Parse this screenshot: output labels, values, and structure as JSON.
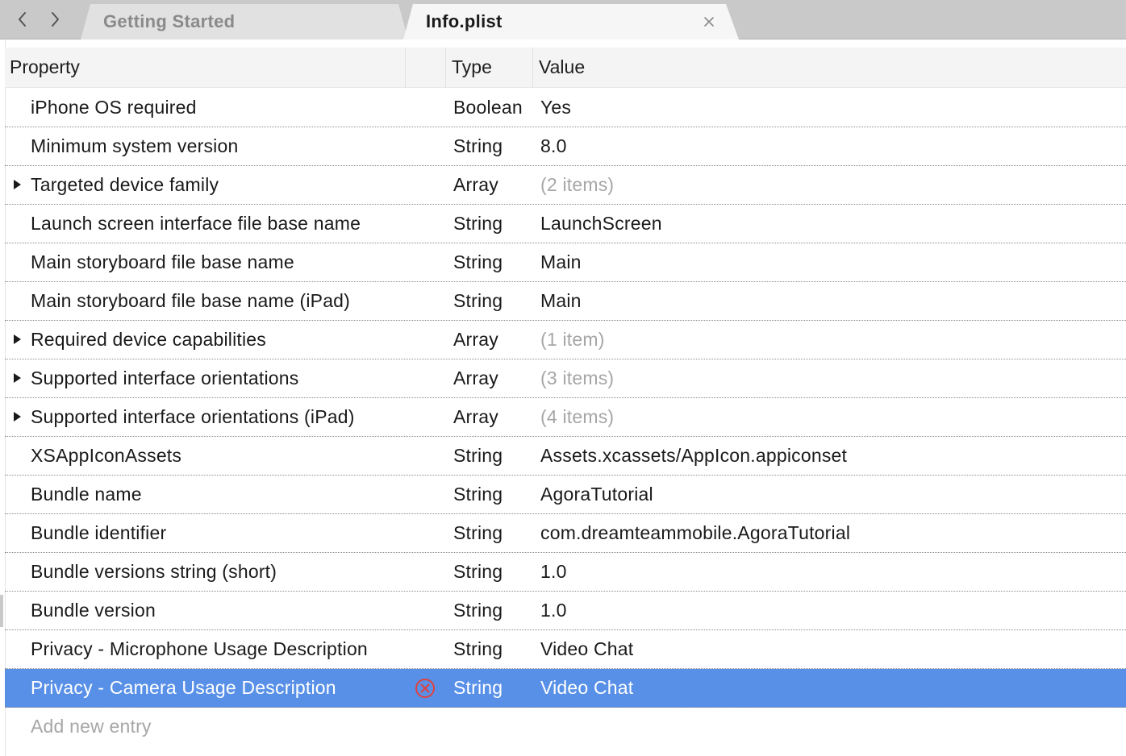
{
  "nav": {
    "back_icon": "chevron-left-icon",
    "forward_icon": "chevron-right-icon"
  },
  "tabs": [
    {
      "label": "Getting Started",
      "active": false
    },
    {
      "label": "Info.plist",
      "active": true,
      "close_icon": "close-icon"
    }
  ],
  "columns": {
    "property": "Property",
    "type": "Type",
    "value": "Value"
  },
  "rows": [
    {
      "property": "iPhone OS required",
      "type": "Boolean",
      "value": "Yes",
      "expandable": false,
      "muted": false
    },
    {
      "property": "Minimum system version",
      "type": "String",
      "value": "8.0",
      "expandable": false,
      "muted": false
    },
    {
      "property": "Targeted device family",
      "type": "Array",
      "value": "(2 items)",
      "expandable": true,
      "muted": true
    },
    {
      "property": "Launch screen interface file base name",
      "type": "String",
      "value": "LaunchScreen",
      "expandable": false,
      "muted": false
    },
    {
      "property": "Main storyboard file base name",
      "type": "String",
      "value": "Main",
      "expandable": false,
      "muted": false
    },
    {
      "property": "Main storyboard file base name (iPad)",
      "type": "String",
      "value": "Main",
      "expandable": false,
      "muted": false
    },
    {
      "property": "Required device capabilities",
      "type": "Array",
      "value": "(1 item)",
      "expandable": true,
      "muted": true
    },
    {
      "property": "Supported interface orientations",
      "type": "Array",
      "value": "(3 items)",
      "expandable": true,
      "muted": true
    },
    {
      "property": "Supported interface orientations (iPad)",
      "type": "Array",
      "value": "(4 items)",
      "expandable": true,
      "muted": true
    },
    {
      "property": "XSAppIconAssets",
      "type": "String",
      "value": "Assets.xcassets/AppIcon.appiconset",
      "expandable": false,
      "muted": false
    },
    {
      "property": "Bundle name",
      "type": "String",
      "value": "AgoraTutorial",
      "expandable": false,
      "muted": false
    },
    {
      "property": "Bundle identifier",
      "type": "String",
      "value": "com.dreamteammobile.AgoraTutorial",
      "expandable": false,
      "muted": false
    },
    {
      "property": "Bundle versions string (short)",
      "type": "String",
      "value": "1.0",
      "expandable": false,
      "muted": false
    },
    {
      "property": "Bundle version",
      "type": "String",
      "value": "1.0",
      "expandable": false,
      "muted": false
    },
    {
      "property": "Privacy - Microphone Usage Description",
      "type": "String",
      "value": "Video Chat",
      "expandable": false,
      "muted": false
    },
    {
      "property": "Privacy - Camera Usage Description",
      "type": "String",
      "value": "Video Chat",
      "expandable": false,
      "muted": false,
      "selected": true,
      "delete_icon": "delete-circle-icon"
    }
  ],
  "add_entry_placeholder": "Add new entry",
  "colors": {
    "selection": "#5890e8",
    "muted_text": "#a6a6a6",
    "delete_icon": "#e0413d",
    "tabbar_bg": "#c9c9c9"
  }
}
